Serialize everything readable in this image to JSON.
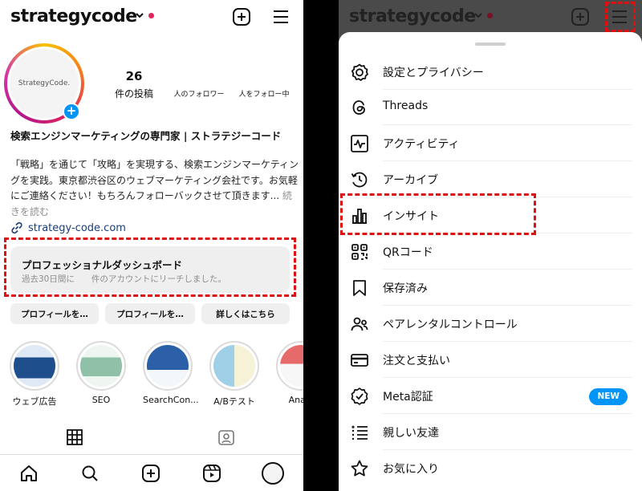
{
  "left": {
    "header": {
      "username": "strategycode"
    },
    "avatar": {
      "text": "StrategyCode."
    },
    "stats": [
      {
        "num": "26",
        "label": "件の投稿"
      },
      {
        "num": "",
        "label": "人のフォロワー"
      },
      {
        "num": "",
        "label": "人をフォロー中"
      }
    ],
    "bio": {
      "name": "検索エンジンマーケティングの専門家 | ストラテジーコード",
      "text": "「戦略」を通じて「攻略」を実現する、検索エンジンマーケティングを実践。東京都渋谷区のウェブマーケティング会社です。お気軽にご連絡ください！もちろんフォローバックさせて頂きます...",
      "more": "続きを読む"
    },
    "link": "strategy-code.com",
    "dashboard": {
      "title": "プロフェッショナルダッシュボード",
      "subtitle": "過去30日間に　　件のアカウントにリーチしました。"
    },
    "buttons": [
      "プロフィールを…",
      "プロフィールを…",
      "詳しくはこちら"
    ],
    "highlights": [
      {
        "label": "ウェブ広告",
        "color": "#1f4e8c"
      },
      {
        "label": "SEO",
        "color": "#8fc0a8"
      },
      {
        "label": "SearchCon...",
        "color": "#2b5fa8"
      },
      {
        "label": "A/Bテスト",
        "color": "#9fd0e8"
      },
      {
        "label": "Analy",
        "color": "#e66a6a"
      }
    ]
  },
  "right": {
    "header": {
      "username": "strategycode"
    },
    "menu": [
      {
        "label": "設定とプライバシー",
        "icon": "settings-gear-icon"
      },
      {
        "label": "Threads",
        "icon": "threads-icon"
      },
      {
        "label": "アクティビティ",
        "icon": "activity-icon"
      },
      {
        "label": "アーカイブ",
        "icon": "archive-icon"
      },
      {
        "label": "インサイト",
        "icon": "insights-bar-chart-icon"
      },
      {
        "label": "QRコード",
        "icon": "qr-code-icon"
      },
      {
        "label": "保存済み",
        "icon": "bookmark-icon"
      },
      {
        "label": "ペアレンタルコントロール",
        "icon": "parental-control-icon"
      },
      {
        "label": "注文と支払い",
        "icon": "credit-card-icon"
      },
      {
        "label": "Meta認証",
        "icon": "verified-badge-icon",
        "badge": "NEW"
      },
      {
        "label": "親しい友達",
        "icon": "close-friends-list-icon"
      },
      {
        "label": "お気に入り",
        "icon": "star-icon"
      }
    ]
  },
  "colors": {
    "accent": "#0095f6",
    "annotation": "#dd1111",
    "notification_dot": "#e0245e"
  }
}
